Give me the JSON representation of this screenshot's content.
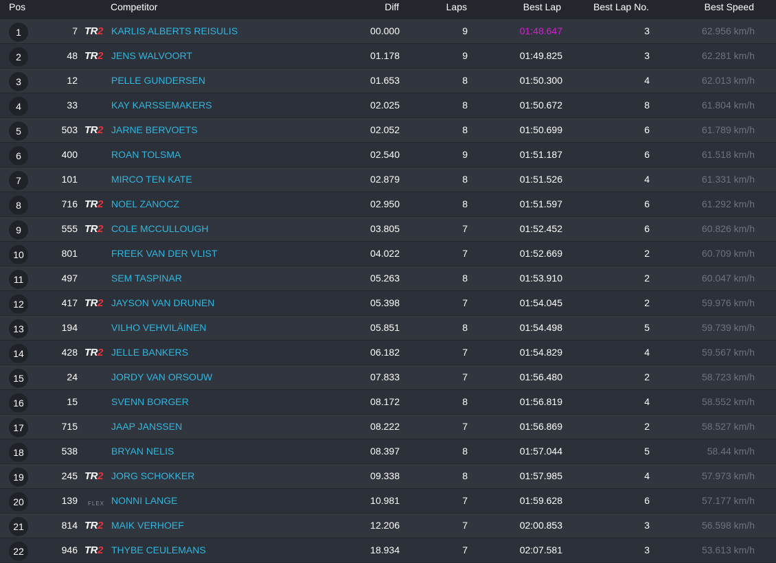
{
  "header": {
    "pos": "Pos",
    "competitor": "Competitor",
    "diff": "Diff",
    "laps": "Laps",
    "best_lap": "Best Lap",
    "best_lap_no": "Best Lap No.",
    "best_speed": "Best Speed"
  },
  "colors": {
    "name": "#2fb6e0",
    "fastest_lap": "#d11fd1",
    "tr2_red": "#e8323c",
    "speed": "#6d727b"
  },
  "rows": [
    {
      "pos": "1",
      "num": "7",
      "cls": "TR2",
      "name": "KARLIS ALBERTS REISULIS",
      "diff": "00.000",
      "laps": "9",
      "best": "01:48.647",
      "bestno": "3",
      "speed": "62.956 km/h",
      "fastest": true
    },
    {
      "pos": "2",
      "num": "48",
      "cls": "TR2",
      "name": "JENS WALVOORT",
      "diff": "01.178",
      "laps": "9",
      "best": "01:49.825",
      "bestno": "3",
      "speed": "62.281 km/h"
    },
    {
      "pos": "3",
      "num": "12",
      "cls": "",
      "name": "PELLE GUNDERSEN",
      "diff": "01.653",
      "laps": "8",
      "best": "01:50.300",
      "bestno": "4",
      "speed": "62.013 km/h"
    },
    {
      "pos": "4",
      "num": "33",
      "cls": "",
      "name": "KAY KARSSEMAKERS",
      "diff": "02.025",
      "laps": "8",
      "best": "01:50.672",
      "bestno": "8",
      "speed": "61.804 km/h"
    },
    {
      "pos": "5",
      "num": "503",
      "cls": "TR2",
      "name": "JARNE BERVOETS",
      "diff": "02.052",
      "laps": "8",
      "best": "01:50.699",
      "bestno": "6",
      "speed": "61.789 km/h"
    },
    {
      "pos": "6",
      "num": "400",
      "cls": "",
      "name": "ROAN TOLSMA",
      "diff": "02.540",
      "laps": "9",
      "best": "01:51.187",
      "bestno": "6",
      "speed": "61.518 km/h"
    },
    {
      "pos": "7",
      "num": "101",
      "cls": "",
      "name": "MIRCO TEN KATE",
      "diff": "02.879",
      "laps": "8",
      "best": "01:51.526",
      "bestno": "4",
      "speed": "61.331 km/h"
    },
    {
      "pos": "8",
      "num": "716",
      "cls": "TR2",
      "name": "NOEL ZANOCZ",
      "diff": "02.950",
      "laps": "8",
      "best": "01:51.597",
      "bestno": "6",
      "speed": "61.292 km/h"
    },
    {
      "pos": "9",
      "num": "555",
      "cls": "TR2",
      "name": "COLE MCCULLOUGH",
      "diff": "03.805",
      "laps": "7",
      "best": "01:52.452",
      "bestno": "6",
      "speed": "60.826 km/h"
    },
    {
      "pos": "10",
      "num": "801",
      "cls": "",
      "name": "FREEK VAN DER VLIST",
      "diff": "04.022",
      "laps": "7",
      "best": "01:52.669",
      "bestno": "2",
      "speed": "60.709 km/h"
    },
    {
      "pos": "11",
      "num": "497",
      "cls": "",
      "name": "SEM TASPINAR",
      "diff": "05.263",
      "laps": "8",
      "best": "01:53.910",
      "bestno": "2",
      "speed": "60.047 km/h"
    },
    {
      "pos": "12",
      "num": "417",
      "cls": "TR2",
      "name": "JAYSON VAN DRUNEN",
      "diff": "05.398",
      "laps": "7",
      "best": "01:54.045",
      "bestno": "2",
      "speed": "59.976 km/h"
    },
    {
      "pos": "13",
      "num": "194",
      "cls": "",
      "name": "VILHO VEHVILÄINEN",
      "diff": "05.851",
      "laps": "8",
      "best": "01:54.498",
      "bestno": "5",
      "speed": "59.739 km/h"
    },
    {
      "pos": "14",
      "num": "428",
      "cls": "TR2",
      "name": "JELLE BANKERS",
      "diff": "06.182",
      "laps": "7",
      "best": "01:54.829",
      "bestno": "4",
      "speed": "59.567 km/h"
    },
    {
      "pos": "15",
      "num": "24",
      "cls": "",
      "name": "JORDY VAN ORSOUW",
      "diff": "07.833",
      "laps": "7",
      "best": "01:56.480",
      "bestno": "2",
      "speed": "58.723 km/h"
    },
    {
      "pos": "16",
      "num": "15",
      "cls": "",
      "name": "SVENN BORGER",
      "diff": "08.172",
      "laps": "8",
      "best": "01:56.819",
      "bestno": "4",
      "speed": "58.552 km/h"
    },
    {
      "pos": "17",
      "num": "715",
      "cls": "",
      "name": "JAAP JANSSEN",
      "diff": "08.222",
      "laps": "7",
      "best": "01:56.869",
      "bestno": "2",
      "speed": "58.527 km/h"
    },
    {
      "pos": "18",
      "num": "538",
      "cls": "",
      "name": "BRYAN NELIS",
      "diff": "08.397",
      "laps": "8",
      "best": "01:57.044",
      "bestno": "5",
      "speed": "58.44 km/h"
    },
    {
      "pos": "19",
      "num": "245",
      "cls": "TR2",
      "name": "JORG SCHOKKER",
      "diff": "09.338",
      "laps": "8",
      "best": "01:57.985",
      "bestno": "4",
      "speed": "57.973 km/h"
    },
    {
      "pos": "20",
      "num": "139",
      "cls": "FLEX",
      "name": "NONNI LANGE",
      "diff": "10.981",
      "laps": "7",
      "best": "01:59.628",
      "bestno": "6",
      "speed": "57.177 km/h"
    },
    {
      "pos": "21",
      "num": "814",
      "cls": "TR2",
      "name": "MAIK VERHOEF",
      "diff": "12.206",
      "laps": "7",
      "best": "02:00.853",
      "bestno": "3",
      "speed": "56.598 km/h"
    },
    {
      "pos": "22",
      "num": "946",
      "cls": "TR2",
      "name": "THYBE CEULEMANS",
      "diff": "18.934",
      "laps": "7",
      "best": "02:07.581",
      "bestno": "3",
      "speed": "53.613 km/h"
    }
  ]
}
